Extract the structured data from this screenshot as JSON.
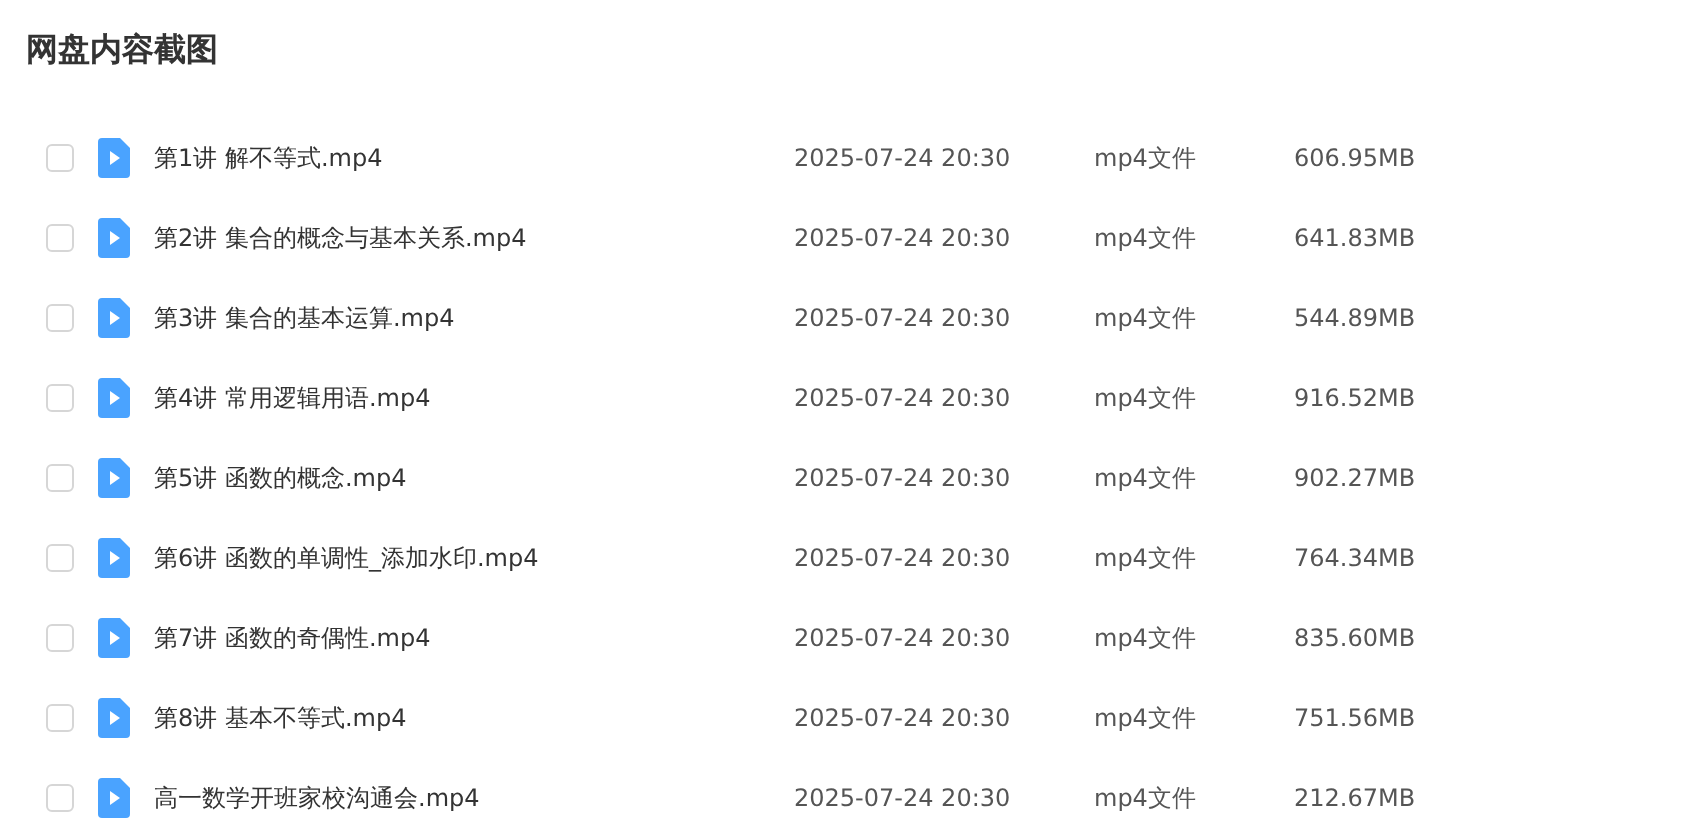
{
  "title": "网盘内容截图",
  "files": [
    {
      "name": "第1讲 解不等式.mp4",
      "date": "2025-07-24 20:30",
      "type": "mp4文件",
      "size": "606.95MB",
      "checked": false
    },
    {
      "name": "第2讲 集合的概念与基本关系.mp4",
      "date": "2025-07-24 20:30",
      "type": "mp4文件",
      "size": "641.83MB",
      "checked": false
    },
    {
      "name": "第3讲 集合的基本运算.mp4",
      "date": "2025-07-24 20:30",
      "type": "mp4文件",
      "size": "544.89MB",
      "checked": false
    },
    {
      "name": "第4讲 常用逻辑用语.mp4",
      "date": "2025-07-24 20:30",
      "type": "mp4文件",
      "size": "916.52MB",
      "checked": false
    },
    {
      "name": "第5讲 函数的概念.mp4",
      "date": "2025-07-24 20:30",
      "type": "mp4文件",
      "size": "902.27MB",
      "checked": false
    },
    {
      "name": "第6讲 函数的单调性_添加水印.mp4",
      "date": "2025-07-24 20:30",
      "type": "mp4文件",
      "size": "764.34MB",
      "checked": false
    },
    {
      "name": "第7讲 函数的奇偶性.mp4",
      "date": "2025-07-24 20:30",
      "type": "mp4文件",
      "size": "835.60MB",
      "checked": false
    },
    {
      "name": "第8讲 基本不等式.mp4",
      "date": "2025-07-24 20:30",
      "type": "mp4文件",
      "size": "751.56MB",
      "checked": false
    },
    {
      "name": "高一数学开班家校沟通会.mp4",
      "date": "2025-07-24 20:30",
      "type": "mp4文件",
      "size": "212.67MB",
      "checked": false
    }
  ]
}
